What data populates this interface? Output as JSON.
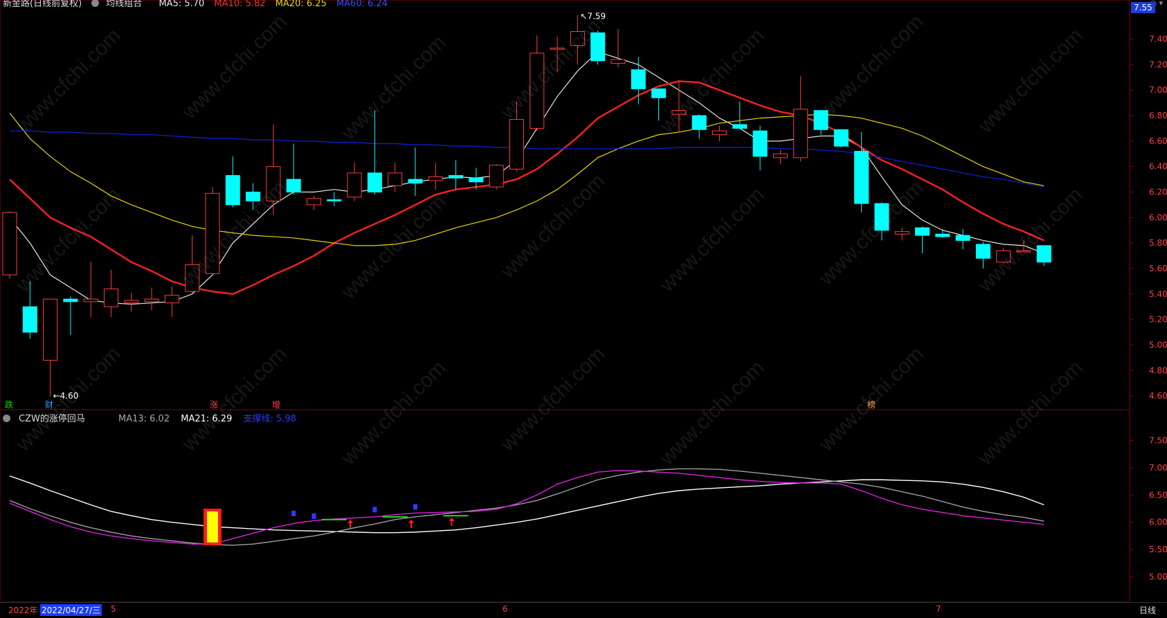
{
  "top_legend": {
    "title": "新金路(日线前复权)",
    "indicator": "均线组合",
    "ma5": "MA5: 5.70",
    "ma10": "MA10: 5.82",
    "ma20": "MA20: 6.25",
    "ma60": "MA60: 6.24"
  },
  "sub_legend": {
    "title": "CZW的涨停回马",
    "ma13": "MA13: 6.02",
    "ma21": "MA21: 6.29",
    "extra": "支撑线: 5.98"
  },
  "price_pill": "7.55",
  "high_label": "7.59",
  "low_label": "4.60",
  "status_bar": {
    "year": "2022年",
    "date": "2022/04/27/三",
    "month5": "5",
    "month6": "6",
    "month7": "7",
    "period": "日线"
  },
  "event_badges": [
    {
      "text": "跌",
      "color": "#00e000"
    },
    {
      "text": "财",
      "color": "#3ea0ff"
    },
    {
      "text": "涨",
      "color": "#ff4040"
    },
    {
      "text": "增",
      "color": "#ff4040"
    },
    {
      "text": "榜",
      "color": "#ffa040"
    }
  ],
  "watermark": "www.cfchi.com",
  "colors": {
    "up": "#ff3b3b",
    "down": "#00ffff",
    "ma5": "#e8e8e8",
    "ma10": "#ff2020",
    "ma20": "#e8d800",
    "ma60": "#1020d0",
    "sub_white": "#ffffff",
    "sub_gray": "#a0a0a0",
    "sub_magenta": "#e020e0"
  },
  "chart_data": [
    {
      "type": "candlestick",
      "title": "新金路(日线前复权)",
      "y_ticks": [
        "7.40",
        "7.20",
        "7.00",
        "6.80",
        "6.60",
        "6.40",
        "6.20",
        "6.00",
        "5.80",
        "5.60",
        "5.40",
        "5.20",
        "5.00",
        "4.80",
        "4.60"
      ],
      "ylim": [
        4.53,
        7.68
      ],
      "candles": [
        {
          "o": 5.55,
          "h": 6.05,
          "l": 5.52,
          "c": 6.04
        },
        {
          "o": 5.3,
          "h": 5.5,
          "l": 5.05,
          "c": 5.1
        },
        {
          "o": 4.88,
          "h": 5.36,
          "l": 4.6,
          "c": 5.36
        },
        {
          "o": 5.36,
          "h": 5.38,
          "l": 5.08,
          "c": 5.34
        },
        {
          "o": 5.34,
          "h": 5.65,
          "l": 5.22,
          "c": 5.36
        },
        {
          "o": 5.3,
          "h": 5.59,
          "l": 5.22,
          "c": 5.44
        },
        {
          "o": 5.33,
          "h": 5.41,
          "l": 5.26,
          "c": 5.35
        },
        {
          "o": 5.34,
          "h": 5.45,
          "l": 5.27,
          "c": 5.36
        },
        {
          "o": 5.33,
          "h": 5.46,
          "l": 5.22,
          "c": 5.39
        },
        {
          "o": 5.42,
          "h": 5.86,
          "l": 5.4,
          "c": 5.63
        },
        {
          "o": 5.56,
          "h": 6.24,
          "l": 5.55,
          "c": 6.19
        },
        {
          "o": 6.33,
          "h": 6.48,
          "l": 6.08,
          "c": 6.1
        },
        {
          "o": 6.2,
          "h": 6.27,
          "l": 6.06,
          "c": 6.13
        },
        {
          "o": 6.13,
          "h": 6.73,
          "l": 6.02,
          "c": 6.4
        },
        {
          "o": 6.3,
          "h": 6.58,
          "l": 6.18,
          "c": 6.2
        },
        {
          "o": 6.1,
          "h": 6.17,
          "l": 6.06,
          "c": 6.15
        },
        {
          "o": 6.14,
          "h": 6.2,
          "l": 6.09,
          "c": 6.13
        },
        {
          "o": 6.16,
          "h": 6.43,
          "l": 6.13,
          "c": 6.35
        },
        {
          "o": 6.35,
          "h": 6.84,
          "l": 6.18,
          "c": 6.2
        },
        {
          "o": 6.25,
          "h": 6.43,
          "l": 6.2,
          "c": 6.35
        },
        {
          "o": 6.3,
          "h": 6.55,
          "l": 6.17,
          "c": 6.27
        },
        {
          "o": 6.29,
          "h": 6.43,
          "l": 6.22,
          "c": 6.32
        },
        {
          "o": 6.33,
          "h": 6.45,
          "l": 6.22,
          "c": 6.31
        },
        {
          "o": 6.31,
          "h": 6.39,
          "l": 6.22,
          "c": 6.28
        },
        {
          "o": 6.24,
          "h": 6.42,
          "l": 6.22,
          "c": 6.41
        },
        {
          "o": 6.38,
          "h": 6.91,
          "l": 6.36,
          "c": 6.77
        },
        {
          "o": 6.7,
          "h": 7.43,
          "l": 6.68,
          "c": 7.29
        },
        {
          "o": 7.32,
          "h": 7.42,
          "l": 7.14,
          "c": 7.33
        },
        {
          "o": 7.35,
          "h": 7.59,
          "l": 7.2,
          "c": 7.46
        },
        {
          "o": 7.45,
          "h": 7.47,
          "l": 7.2,
          "c": 7.23
        },
        {
          "o": 7.21,
          "h": 7.48,
          "l": 7.18,
          "c": 7.24
        },
        {
          "o": 7.16,
          "h": 7.26,
          "l": 6.89,
          "c": 7.01
        },
        {
          "o": 7.01,
          "h": 7.01,
          "l": 6.76,
          "c": 6.94
        },
        {
          "o": 6.81,
          "h": 7.08,
          "l": 6.67,
          "c": 6.84
        },
        {
          "o": 6.8,
          "h": 6.81,
          "l": 6.62,
          "c": 6.69
        },
        {
          "o": 6.65,
          "h": 6.72,
          "l": 6.6,
          "c": 6.68
        },
        {
          "o": 6.73,
          "h": 6.91,
          "l": 6.7,
          "c": 6.7
        },
        {
          "o": 6.68,
          "h": 6.72,
          "l": 6.37,
          "c": 6.48
        },
        {
          "o": 6.47,
          "h": 6.53,
          "l": 6.42,
          "c": 6.5
        },
        {
          "o": 6.47,
          "h": 7.11,
          "l": 6.44,
          "c": 6.85
        },
        {
          "o": 6.84,
          "h": 6.84,
          "l": 6.65,
          "c": 6.69
        },
        {
          "o": 6.69,
          "h": 6.69,
          "l": 6.55,
          "c": 6.56
        },
        {
          "o": 6.52,
          "h": 6.67,
          "l": 6.04,
          "c": 6.11
        },
        {
          "o": 6.11,
          "h": 6.12,
          "l": 5.82,
          "c": 5.9
        },
        {
          "o": 5.87,
          "h": 5.92,
          "l": 5.82,
          "c": 5.89
        },
        {
          "o": 5.92,
          "h": 5.93,
          "l": 5.72,
          "c": 5.86
        },
        {
          "o": 5.87,
          "h": 5.91,
          "l": 5.84,
          "c": 5.85
        },
        {
          "o": 5.86,
          "h": 5.91,
          "l": 5.75,
          "c": 5.82
        },
        {
          "o": 5.79,
          "h": 5.81,
          "l": 5.6,
          "c": 5.68
        },
        {
          "o": 5.65,
          "h": 5.76,
          "l": 5.64,
          "c": 5.74
        },
        {
          "o": 5.73,
          "h": 5.82,
          "l": 5.73,
          "c": 5.74
        },
        {
          "o": 5.78,
          "h": 5.78,
          "l": 5.62,
          "c": 5.65
        }
      ],
      "series": [
        {
          "name": "MA5",
          "values": [
            6.0,
            5.8,
            5.55,
            5.45,
            5.35,
            5.33,
            5.32,
            5.33,
            5.34,
            5.4,
            5.55,
            5.8,
            5.95,
            6.1,
            6.2,
            6.2,
            6.22,
            6.2,
            6.22,
            6.25,
            6.28,
            6.3,
            6.32,
            6.31,
            6.33,
            6.45,
            6.7,
            6.95,
            7.15,
            7.3,
            7.25,
            7.2,
            7.1,
            7.0,
            6.9,
            6.78,
            6.7,
            6.6,
            6.6,
            6.62,
            6.64,
            6.64,
            6.55,
            6.32,
            6.1,
            5.98,
            5.9,
            5.86,
            5.82,
            5.79,
            5.78,
            5.72
          ]
        },
        {
          "name": "MA10",
          "values": [
            6.3,
            6.15,
            6.0,
            5.92,
            5.85,
            5.75,
            5.65,
            5.58,
            5.5,
            5.45,
            5.42,
            5.4,
            5.47,
            5.55,
            5.62,
            5.7,
            5.8,
            5.88,
            5.95,
            6.02,
            6.1,
            6.18,
            6.22,
            6.24,
            6.26,
            6.3,
            6.38,
            6.5,
            6.63,
            6.78,
            6.87,
            6.96,
            7.03,
            7.07,
            7.06,
            7.0,
            6.94,
            6.88,
            6.83,
            6.8,
            6.74,
            6.66,
            6.55,
            6.45,
            6.38,
            6.3,
            6.22,
            6.12,
            6.03,
            5.95,
            5.89,
            5.82
          ]
        },
        {
          "name": "MA20",
          "values": [
            6.82,
            6.62,
            6.48,
            6.36,
            6.27,
            6.17,
            6.1,
            6.04,
            5.98,
            5.93,
            5.9,
            5.88,
            5.86,
            5.85,
            5.84,
            5.82,
            5.8,
            5.78,
            5.78,
            5.79,
            5.82,
            5.87,
            5.92,
            5.96,
            6.0,
            6.06,
            6.13,
            6.22,
            6.34,
            6.47,
            6.54,
            6.6,
            6.65,
            6.67,
            6.7,
            6.74,
            6.76,
            6.78,
            6.79,
            6.8,
            6.81,
            6.8,
            6.78,
            6.74,
            6.7,
            6.64,
            6.56,
            6.48,
            6.4,
            6.34,
            6.28,
            6.25
          ]
        },
        {
          "name": "MA60",
          "values": [
            6.68,
            6.68,
            6.67,
            6.67,
            6.66,
            6.66,
            6.65,
            6.65,
            6.64,
            6.63,
            6.62,
            6.62,
            6.61,
            6.61,
            6.6,
            6.6,
            6.59,
            6.59,
            6.58,
            6.58,
            6.57,
            6.57,
            6.56,
            6.56,
            6.55,
            6.55,
            6.54,
            6.54,
            6.54,
            6.54,
            6.54,
            6.54,
            6.54,
            6.55,
            6.55,
            6.55,
            6.55,
            6.55,
            6.54,
            6.54,
            6.53,
            6.52,
            6.5,
            6.47,
            6.44,
            6.41,
            6.38,
            6.35,
            6.32,
            6.3,
            6.27,
            6.24
          ]
        }
      ]
    },
    {
      "type": "line",
      "title": "CZW的涨停回马",
      "y_ticks": [
        "7.50",
        "7.00",
        "6.50",
        "6.00",
        "5.50",
        "5.00"
      ],
      "ylim": [
        4.6,
        7.9
      ],
      "series": [
        {
          "name": "MA21",
          "values": [
            6.85,
            6.72,
            6.58,
            6.45,
            6.32,
            6.2,
            6.12,
            6.05,
            6.0,
            5.96,
            5.92,
            5.9,
            5.88,
            5.86,
            5.85,
            5.84,
            5.83,
            5.82,
            5.81,
            5.81,
            5.82,
            5.84,
            5.86,
            5.9,
            5.95,
            6.0,
            6.06,
            6.14,
            6.22,
            6.3,
            6.38,
            6.46,
            6.53,
            6.58,
            6.61,
            6.63,
            6.65,
            6.67,
            6.7,
            6.72,
            6.74,
            6.76,
            6.78,
            6.78,
            6.77,
            6.76,
            6.74,
            6.7,
            6.64,
            6.56,
            6.46,
            6.32
          ]
        },
        {
          "name": "MA13",
          "values": [
            6.4,
            6.25,
            6.12,
            6.0,
            5.9,
            5.82,
            5.75,
            5.7,
            5.66,
            5.62,
            5.59,
            5.58,
            5.6,
            5.65,
            5.7,
            5.75,
            5.82,
            5.9,
            5.97,
            6.05,
            6.1,
            6.14,
            6.18,
            6.22,
            6.26,
            6.32,
            6.4,
            6.52,
            6.65,
            6.78,
            6.86,
            6.92,
            6.96,
            6.98,
            6.98,
            6.97,
            6.94,
            6.9,
            6.86,
            6.82,
            6.78,
            6.74,
            6.7,
            6.64,
            6.56,
            6.48,
            6.38,
            6.28,
            6.2,
            6.14,
            6.09,
            6.02
          ]
        },
        {
          "name": "支撑线",
          "values": [
            6.35,
            6.2,
            6.05,
            5.92,
            5.82,
            5.75,
            5.7,
            5.66,
            5.63,
            5.6,
            5.6,
            5.7,
            5.8,
            5.9,
            5.98,
            6.03,
            6.06,
            6.08,
            6.1,
            6.14,
            6.17,
            6.18,
            6.19,
            6.2,
            6.24,
            6.34,
            6.5,
            6.7,
            6.82,
            6.92,
            6.95,
            6.94,
            6.92,
            6.9,
            6.86,
            6.82,
            6.78,
            6.75,
            6.73,
            6.72,
            6.72,
            6.7,
            6.58,
            6.44,
            6.32,
            6.24,
            6.18,
            6.12,
            6.08,
            6.04,
            6.0,
            5.96
          ]
        }
      ],
      "highlight_bar": {
        "index": 10,
        "from": 5.58,
        "to": 6.25
      },
      "signal_arrows": [
        17,
        20,
        22
      ],
      "blue_marks": [
        {
          "index": 14,
          "value": 6.15
        },
        {
          "index": 15,
          "value": 6.1
        },
        {
          "index": 18,
          "value": 6.22
        },
        {
          "index": 20,
          "value": 6.27
        }
      ],
      "green_marks": [
        {
          "index": 16,
          "value": 6.05
        },
        {
          "index": 19,
          "value": 6.1
        },
        {
          "index": 22,
          "value": 6.12
        }
      ]
    }
  ]
}
